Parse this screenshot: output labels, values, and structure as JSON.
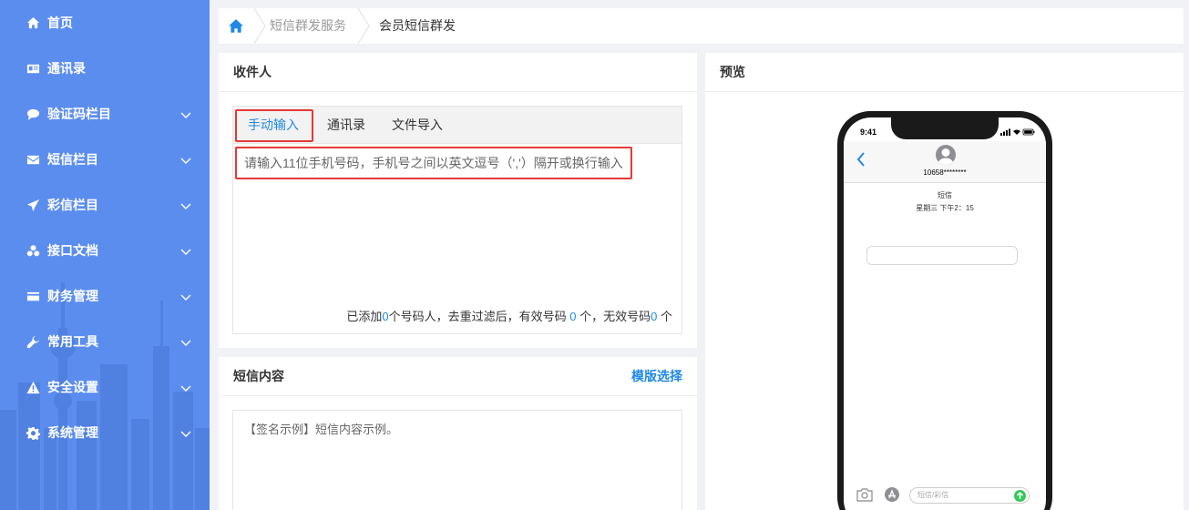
{
  "sidebar": {
    "items": [
      {
        "label": "首页",
        "icon": "home-icon",
        "expandable": false
      },
      {
        "label": "通讯录",
        "icon": "contact-card-icon",
        "expandable": false
      },
      {
        "label": "验证码栏目",
        "icon": "chat-bubble-icon",
        "expandable": true
      },
      {
        "label": "短信栏目",
        "icon": "envelope-icon",
        "expandable": true
      },
      {
        "label": "彩信栏目",
        "icon": "paper-plane-icon",
        "expandable": true
      },
      {
        "label": "接口文档",
        "icon": "cubes-icon",
        "expandable": true
      },
      {
        "label": "财务管理",
        "icon": "credit-card-icon",
        "expandable": true
      },
      {
        "label": "常用工具",
        "icon": "wrench-icon",
        "expandable": true
      },
      {
        "label": "安全设置",
        "icon": "warning-icon",
        "expandable": true
      },
      {
        "label": "系统管理",
        "icon": "gear-icon",
        "expandable": true
      }
    ]
  },
  "breadcrumb": {
    "home_icon": "home-icon",
    "items": [
      "短信群发服务",
      "会员短信群发"
    ]
  },
  "recipients": {
    "title": "收件人",
    "tabs": [
      "手动输入",
      "通讯录",
      "文件导入"
    ],
    "active_tab": 0,
    "placeholder": "请输入11位手机号码，手机号之间以英文逗号（','）隔开或换行输入",
    "count": {
      "prefix": "已添加",
      "added": "0",
      "mid1": "个号码人，去重过滤后，有效号码 ",
      "valid": "0",
      "mid2": " 个，无效号码",
      "invalid": "0",
      "suffix": " 个"
    }
  },
  "content": {
    "title": "短信内容",
    "template_link": "模版选择",
    "text": "【签名示例】短信内容示例。"
  },
  "preview": {
    "title": "预览",
    "status_time": "9:41",
    "sender": "10658********",
    "message_type": "短信",
    "message_time": "星期三 下午2：15",
    "composer_placeholder": "短信/彩信"
  },
  "colors": {
    "sidebar_bg": "#5b8def",
    "accent": "#1e88e5",
    "highlight_border": "#e53935"
  }
}
